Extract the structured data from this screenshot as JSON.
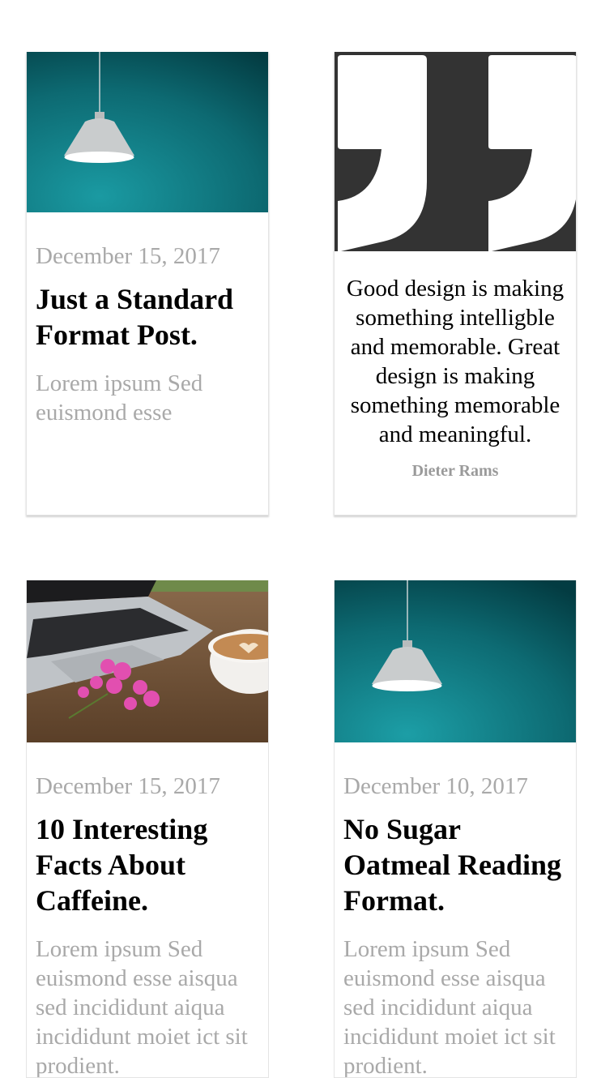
{
  "posts": [
    {
      "date": "December 15, 2017",
      "title": "Just a Standard Format Post.",
      "excerpt": "Lorem ipsum Sed euismond esse",
      "image": "teal-lamp-image"
    },
    {
      "quote": "Good design is making something intelligble and memorable. Great design is making something memorable and meaningful.",
      "author": "Dieter Rams",
      "image": "quotation-mark-icon"
    },
    {
      "date": "December 15, 2017",
      "title": "10 Interesting Facts About Caffeine.",
      "excerpt": "Lorem ipsum Sed euismond esse aisqua sed incididunt aiqua incididunt moiet ict sit prodient.",
      "image": "laptop-coffee-image"
    },
    {
      "date": "December 10, 2017",
      "title": "No Sugar Oatmeal Reading Format.",
      "excerpt": "Lorem ipsum Sed euismond esse aisqua sed incididunt aiqua incididunt moiet ict sit prodient.",
      "image": "teal-lamp-image"
    }
  ],
  "colors": {
    "teal": "#0f6e75",
    "quote_bg": "#333333",
    "meta_gray": "#a9a9a9"
  }
}
